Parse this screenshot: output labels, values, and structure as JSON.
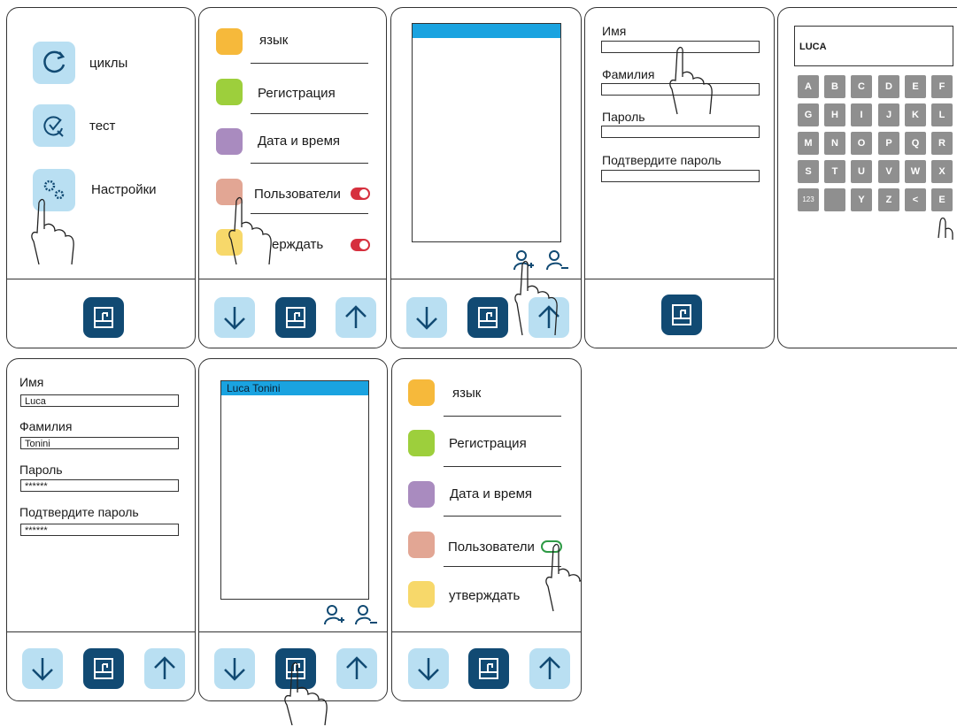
{
  "colors": {
    "tile_light": "#b9dff2",
    "tile_dark": "#114a73",
    "toggle_red": "#d6303e",
    "toggle_green": "#2e9a45",
    "list_header": "#1aa3e0",
    "key_gray": "#8f8f8f"
  },
  "panel1": {
    "items": [
      {
        "label": "циклы",
        "icon": "refresh-icon"
      },
      {
        "label": "тест",
        "icon": "test-icon"
      },
      {
        "label": "Настройки",
        "icon": "gears-icon"
      }
    ]
  },
  "settings": {
    "items": [
      {
        "label": "язык",
        "icon": "language-icon",
        "color": "#f6b93b"
      },
      {
        "label": "Регистрация",
        "icon": "user-add-icon",
        "color": "#9dcf3c"
      },
      {
        "label": "Дата и время",
        "icon": "clock-icon",
        "color": "#a98bbf"
      },
      {
        "label": "Пользователи",
        "icon": "users-icon",
        "color": "#e2a694"
      },
      {
        "label": "утверждать",
        "icon": "approve-icon",
        "color": "#f7d86a"
      }
    ],
    "panel2_labels": [
      "язык",
      "Регистрация",
      "Дата и время",
      "Пользователи",
      "утверждать"
    ],
    "panel2_visible_tail": "ерждать"
  },
  "user_form": {
    "labels": {
      "name": "Имя",
      "surname": "Фамилия",
      "password": "Пароль",
      "confirm": "Подтвердите пароль"
    },
    "values": {
      "name": "Luca",
      "surname": "Tonini",
      "password": "******",
      "confirm": "******"
    }
  },
  "keyboard": {
    "display": "LUCA",
    "rows": [
      [
        "A",
        "B",
        "C",
        "D",
        "E",
        "F"
      ],
      [
        "G",
        "H",
        "I",
        "J",
        "K",
        "L"
      ],
      [
        "M",
        "N",
        "O",
        "P",
        "Q",
        "R"
      ],
      [
        "S",
        "T",
        "U",
        "V",
        "W",
        "X"
      ],
      [
        "123",
        "",
        "Y",
        "Z",
        "<",
        "E"
      ]
    ]
  },
  "user_list": {
    "entries": [
      "Luca Tonini"
    ]
  }
}
